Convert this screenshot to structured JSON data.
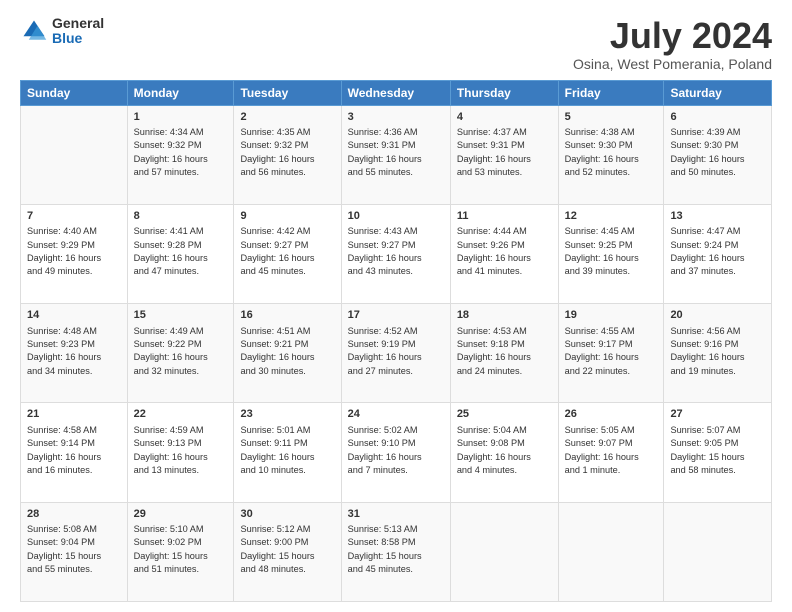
{
  "logo": {
    "general": "General",
    "blue": "Blue"
  },
  "title": "July 2024",
  "subtitle": "Osina, West Pomerania, Poland",
  "header_days": [
    "Sunday",
    "Monday",
    "Tuesday",
    "Wednesday",
    "Thursday",
    "Friday",
    "Saturday"
  ],
  "weeks": [
    [
      {
        "day": "",
        "info": ""
      },
      {
        "day": "1",
        "info": "Sunrise: 4:34 AM\nSunset: 9:32 PM\nDaylight: 16 hours\nand 57 minutes."
      },
      {
        "day": "2",
        "info": "Sunrise: 4:35 AM\nSunset: 9:32 PM\nDaylight: 16 hours\nand 56 minutes."
      },
      {
        "day": "3",
        "info": "Sunrise: 4:36 AM\nSunset: 9:31 PM\nDaylight: 16 hours\nand 55 minutes."
      },
      {
        "day": "4",
        "info": "Sunrise: 4:37 AM\nSunset: 9:31 PM\nDaylight: 16 hours\nand 53 minutes."
      },
      {
        "day": "5",
        "info": "Sunrise: 4:38 AM\nSunset: 9:30 PM\nDaylight: 16 hours\nand 52 minutes."
      },
      {
        "day": "6",
        "info": "Sunrise: 4:39 AM\nSunset: 9:30 PM\nDaylight: 16 hours\nand 50 minutes."
      }
    ],
    [
      {
        "day": "7",
        "info": "Sunrise: 4:40 AM\nSunset: 9:29 PM\nDaylight: 16 hours\nand 49 minutes."
      },
      {
        "day": "8",
        "info": "Sunrise: 4:41 AM\nSunset: 9:28 PM\nDaylight: 16 hours\nand 47 minutes."
      },
      {
        "day": "9",
        "info": "Sunrise: 4:42 AM\nSunset: 9:27 PM\nDaylight: 16 hours\nand 45 minutes."
      },
      {
        "day": "10",
        "info": "Sunrise: 4:43 AM\nSunset: 9:27 PM\nDaylight: 16 hours\nand 43 minutes."
      },
      {
        "day": "11",
        "info": "Sunrise: 4:44 AM\nSunset: 9:26 PM\nDaylight: 16 hours\nand 41 minutes."
      },
      {
        "day": "12",
        "info": "Sunrise: 4:45 AM\nSunset: 9:25 PM\nDaylight: 16 hours\nand 39 minutes."
      },
      {
        "day": "13",
        "info": "Sunrise: 4:47 AM\nSunset: 9:24 PM\nDaylight: 16 hours\nand 37 minutes."
      }
    ],
    [
      {
        "day": "14",
        "info": "Sunrise: 4:48 AM\nSunset: 9:23 PM\nDaylight: 16 hours\nand 34 minutes."
      },
      {
        "day": "15",
        "info": "Sunrise: 4:49 AM\nSunset: 9:22 PM\nDaylight: 16 hours\nand 32 minutes."
      },
      {
        "day": "16",
        "info": "Sunrise: 4:51 AM\nSunset: 9:21 PM\nDaylight: 16 hours\nand 30 minutes."
      },
      {
        "day": "17",
        "info": "Sunrise: 4:52 AM\nSunset: 9:19 PM\nDaylight: 16 hours\nand 27 minutes."
      },
      {
        "day": "18",
        "info": "Sunrise: 4:53 AM\nSunset: 9:18 PM\nDaylight: 16 hours\nand 24 minutes."
      },
      {
        "day": "19",
        "info": "Sunrise: 4:55 AM\nSunset: 9:17 PM\nDaylight: 16 hours\nand 22 minutes."
      },
      {
        "day": "20",
        "info": "Sunrise: 4:56 AM\nSunset: 9:16 PM\nDaylight: 16 hours\nand 19 minutes."
      }
    ],
    [
      {
        "day": "21",
        "info": "Sunrise: 4:58 AM\nSunset: 9:14 PM\nDaylight: 16 hours\nand 16 minutes."
      },
      {
        "day": "22",
        "info": "Sunrise: 4:59 AM\nSunset: 9:13 PM\nDaylight: 16 hours\nand 13 minutes."
      },
      {
        "day": "23",
        "info": "Sunrise: 5:01 AM\nSunset: 9:11 PM\nDaylight: 16 hours\nand 10 minutes."
      },
      {
        "day": "24",
        "info": "Sunrise: 5:02 AM\nSunset: 9:10 PM\nDaylight: 16 hours\nand 7 minutes."
      },
      {
        "day": "25",
        "info": "Sunrise: 5:04 AM\nSunset: 9:08 PM\nDaylight: 16 hours\nand 4 minutes."
      },
      {
        "day": "26",
        "info": "Sunrise: 5:05 AM\nSunset: 9:07 PM\nDaylight: 16 hours\nand 1 minute."
      },
      {
        "day": "27",
        "info": "Sunrise: 5:07 AM\nSunset: 9:05 PM\nDaylight: 15 hours\nand 58 minutes."
      }
    ],
    [
      {
        "day": "28",
        "info": "Sunrise: 5:08 AM\nSunset: 9:04 PM\nDaylight: 15 hours\nand 55 minutes."
      },
      {
        "day": "29",
        "info": "Sunrise: 5:10 AM\nSunset: 9:02 PM\nDaylight: 15 hours\nand 51 minutes."
      },
      {
        "day": "30",
        "info": "Sunrise: 5:12 AM\nSunset: 9:00 PM\nDaylight: 15 hours\nand 48 minutes."
      },
      {
        "day": "31",
        "info": "Sunrise: 5:13 AM\nSunset: 8:58 PM\nDaylight: 15 hours\nand 45 minutes."
      },
      {
        "day": "",
        "info": ""
      },
      {
        "day": "",
        "info": ""
      },
      {
        "day": "",
        "info": ""
      }
    ]
  ]
}
